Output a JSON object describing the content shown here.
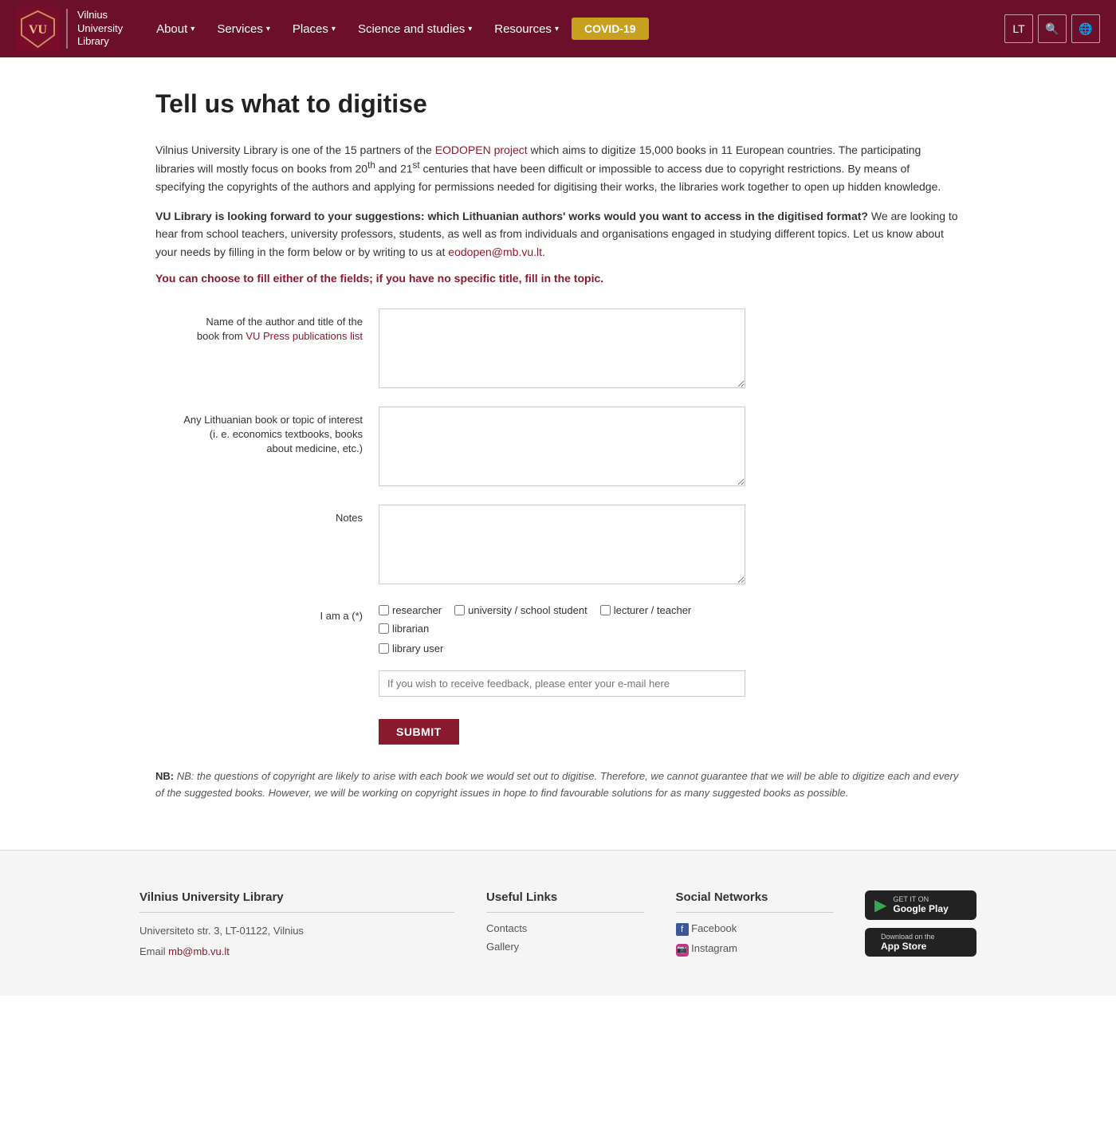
{
  "header": {
    "logo_line1": "Vilnius",
    "logo_line2": "University",
    "logo_line3": "Library",
    "nav": [
      {
        "label": "About",
        "has_arrow": true
      },
      {
        "label": "Services",
        "has_arrow": true
      },
      {
        "label": "Places",
        "has_arrow": true
      },
      {
        "label": "Science and studies",
        "has_arrow": true
      },
      {
        "label": "Resources",
        "has_arrow": true
      }
    ],
    "covid_label": "COVID-19",
    "lang_btn": "LT",
    "search_icon": "🔍",
    "globe_icon": "🌐"
  },
  "page": {
    "title": "Tell us what to digitise",
    "intro1": "Vilnius University Library is one of the 15 partners of the ",
    "eodopen_link": "EODOPEN project",
    "intro1b": " which aims to digitize 15,000 books in 11 European countries. The participating libraries will mostly focus on books from 20",
    "intro1_sup1": "th",
    "intro1c": " and 21",
    "intro1_sup2": "st",
    "intro1d": " centuries that have been difficult or impossible to access due to copyright restrictions. By means of specifying the copyrights of the authors and applying for permissions needed for digitising their works, the libraries work together to open up hidden knowledge.",
    "intro2_bold": "VU Library is looking forward to your suggestions: which Lithuanian authors' works would you want to access in the digitised format?",
    "intro2_rest1": " We are looking to hear from school teachers, university professors, students, as well as from individuals and organisations engaged in studying different topics. Let us know about your needs by filling in the form below or by writing to us at ",
    "intro2_email": "eodopen@mb.vu.lt",
    "intro2_rest2": ".",
    "choice_note": "You can choose to fill either of the fields; if you have no specific title, fill in the topic.",
    "form": {
      "field1_label_a": "Name of the author and title of the",
      "field1_label_b": "book from ",
      "field1_link": "VU Press publications list",
      "field1_placeholder": "",
      "field2_label": "Any Lithuanian book or topic of interest\n(i. e. economics textbooks, books\nabout medicine, etc.)",
      "field2_placeholder": "",
      "field3_label": "Notes",
      "field3_placeholder": "",
      "role_label": "I am a (*)",
      "roles": [
        {
          "label": "researcher",
          "id": "role_researcher"
        },
        {
          "label": "university / school student",
          "id": "role_student"
        },
        {
          "label": "lecturer / teacher",
          "id": "role_teacher"
        },
        {
          "label": "librarian",
          "id": "role_librarian"
        },
        {
          "label": "library user",
          "id": "role_user"
        }
      ],
      "email_placeholder": "If you wish to receive feedback, please enter your e-mail here",
      "submit_label": "SUBMIT"
    },
    "nb_note": "NB: the questions of copyright are likely to arise with each book we would set out to digitise. Therefore, we cannot guarantee that we will be able to digitize each and every of the suggested books. However, we will be working on copyright issues in hope to find favourable solutions for as many suggested books as possible."
  },
  "footer": {
    "col1": {
      "title": "Vilnius University Library",
      "address": "Universiteto str. 3, LT-01122, Vilnius",
      "email_label": "Email ",
      "email": "mb@mb.vu.lt"
    },
    "col2": {
      "title": "Useful Links",
      "links": [
        {
          "label": "Contacts",
          "href": "#"
        },
        {
          "label": "Gallery",
          "href": "#"
        }
      ]
    },
    "col3": {
      "title": "Social Networks",
      "links": [
        {
          "label": "Facebook",
          "icon": "f",
          "href": "#"
        },
        {
          "label": "Instagram",
          "icon": "📷",
          "href": "#"
        }
      ]
    },
    "apps": {
      "google_play": {
        "small": "GET IT ON",
        "big": "Google Play",
        "icon": "▶"
      },
      "app_store": {
        "small": "Download on the",
        "big": "App Store",
        "icon": ""
      }
    }
  }
}
